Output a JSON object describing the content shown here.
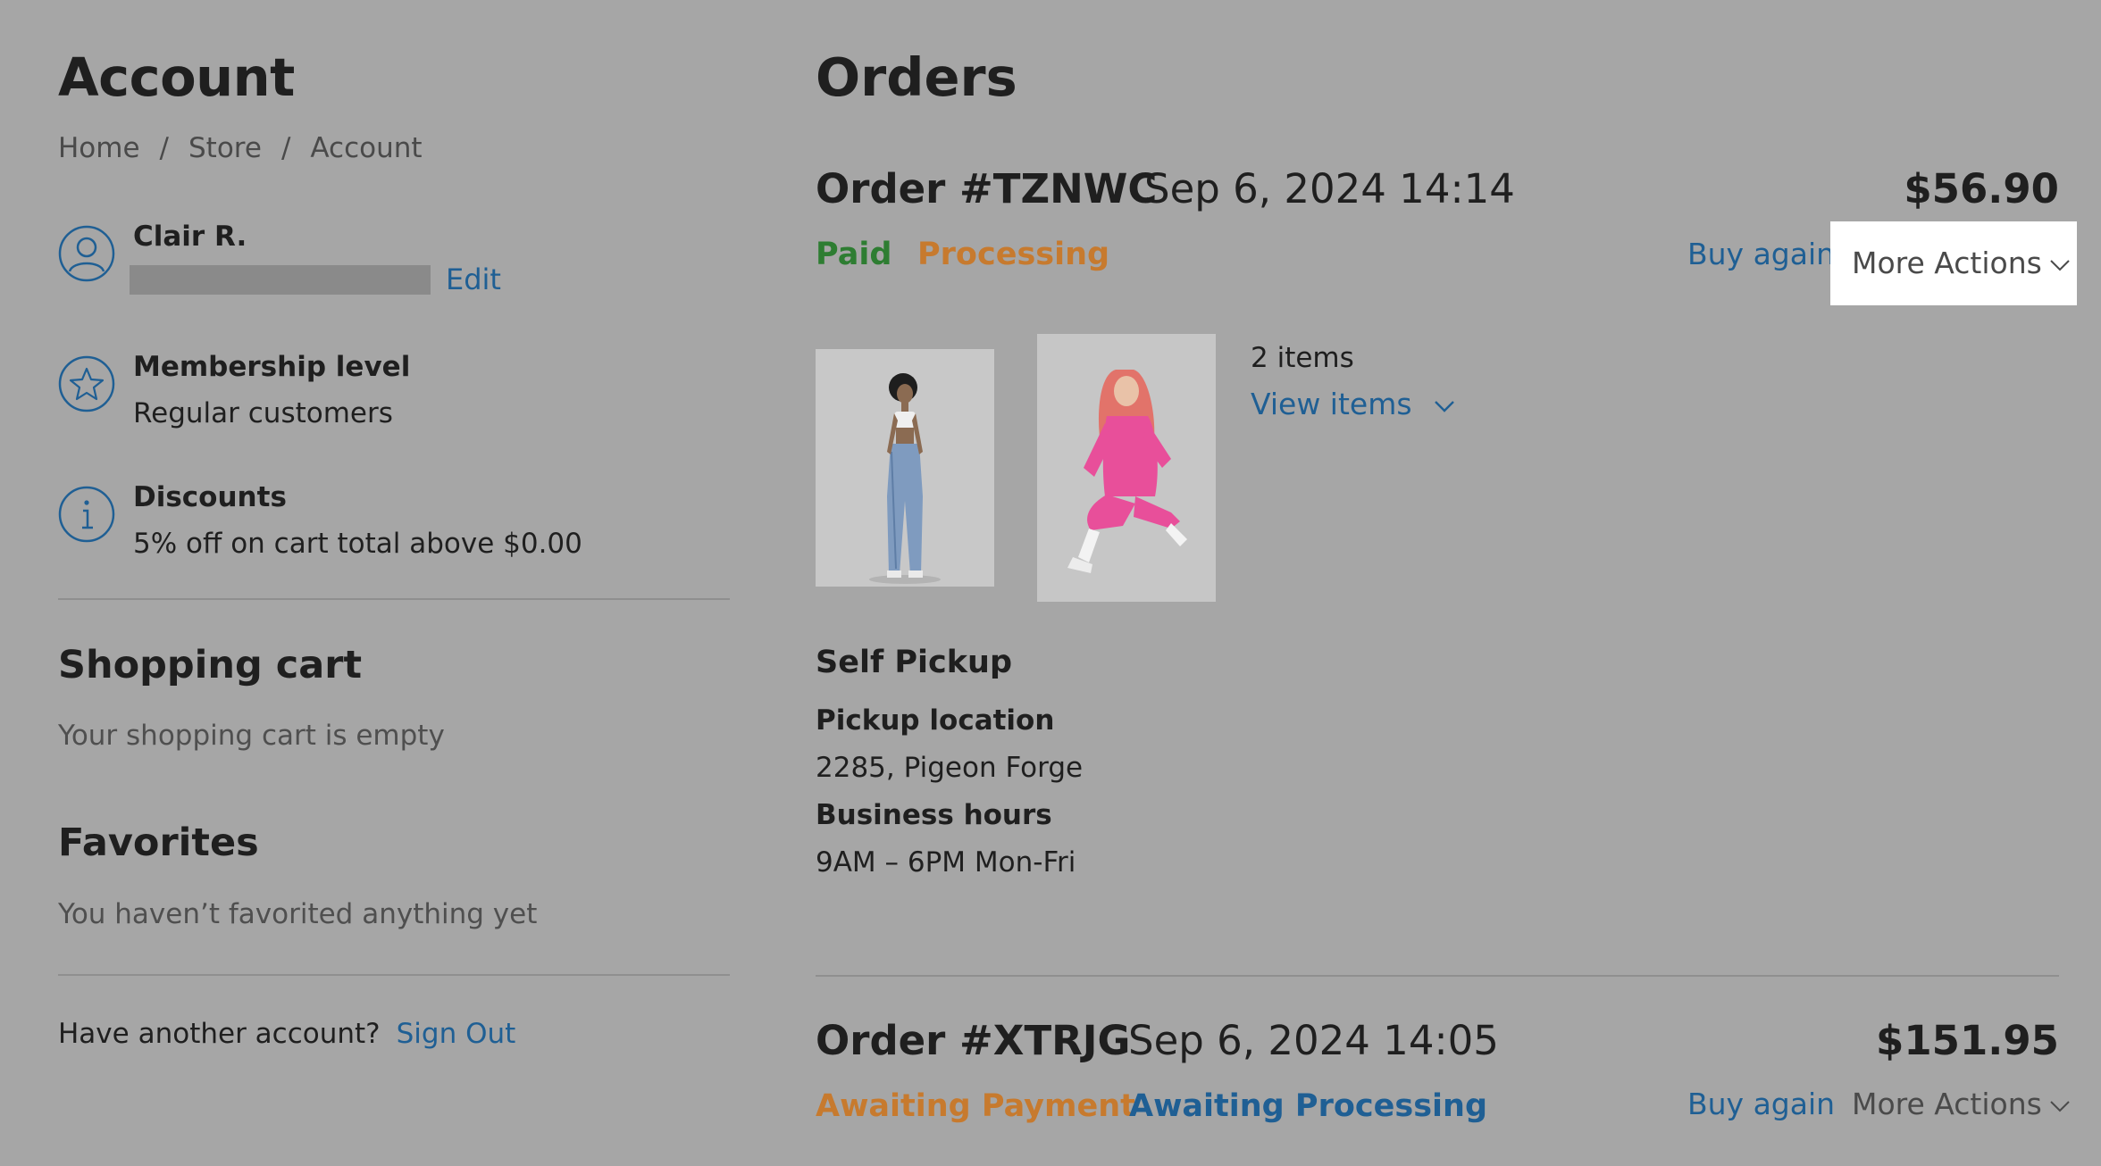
{
  "account": {
    "title": "Account",
    "breadcrumb": [
      "Home",
      "Store",
      "Account"
    ],
    "breadcrumb_sep": "/",
    "user": {
      "name": "Clair R.",
      "edit_label": "Edit",
      "icon": "user-icon"
    },
    "membership": {
      "title": "Membership level",
      "value": "Regular customers",
      "icon": "star-icon"
    },
    "discounts": {
      "title": "Discounts",
      "value": "5% off on cart total above $0.00",
      "icon": "info-icon"
    },
    "cart": {
      "title": "Shopping cart",
      "empty_text": "Your shopping cart is empty"
    },
    "favorites": {
      "title": "Favorites",
      "empty_text": "You haven’t favorited anything yet"
    },
    "signout": {
      "prompt": "Have another account?",
      "link": "Sign Out"
    }
  },
  "orders": {
    "title": "Orders",
    "list": [
      {
        "id": "Order #TZNWC",
        "date": "Sep 6, 2024 14:14",
        "total": "$56.90",
        "payment_status": "Paid",
        "fulfillment_status": "Processing",
        "buy_again": "Buy again",
        "more_actions": "More Actions",
        "items_count": "2 items",
        "view_items": "View items",
        "delivery_method": "Self Pickup",
        "pickup_location_label": "Pickup location",
        "pickup_location": "2285, Pigeon Forge",
        "business_hours_label": "Business hours",
        "business_hours": "9AM – 6PM Mon-Fri"
      },
      {
        "id": "Order #XTRJG",
        "date": "Sep 6, 2024 14:05",
        "total": "$151.95",
        "payment_status": "Awaiting Payment",
        "fulfillment_status": "Awaiting Processing",
        "buy_again": "Buy again",
        "more_actions": "More Actions"
      }
    ]
  },
  "colors": {
    "overlay_background": "#a6a6a6",
    "link": "#1f5f94",
    "paid": "#2e7d32",
    "processing": "#c77a2e",
    "awaiting_payment": "#c77a2e",
    "awaiting_processing": "#1f5f94",
    "highlight": "#ffffff"
  }
}
